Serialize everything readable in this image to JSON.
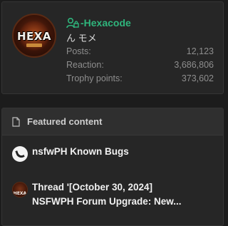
{
  "profile": {
    "avatar_text": "HEXA",
    "username": "-Hexacode",
    "user_title": "ん モメ",
    "stats": [
      {
        "label": "Posts:",
        "value": "12,123"
      },
      {
        "label": "Reaction:",
        "value": "3,686,806"
      },
      {
        "label": "Trophy points:",
        "value": "373,602"
      }
    ],
    "username_color": "#2fb57c"
  },
  "featured": {
    "header": "Featured content",
    "items": [
      {
        "title": "nsfwPH Known Bugs",
        "icon": "hook-avatar-icon"
      },
      {
        "title_line1": "Thread '[October 30, 2024]",
        "title_line2": "NSFWPH Forum Upgrade: New...",
        "icon": "hexa-avatar-icon",
        "avatar_text": "HEXA"
      }
    ]
  }
}
